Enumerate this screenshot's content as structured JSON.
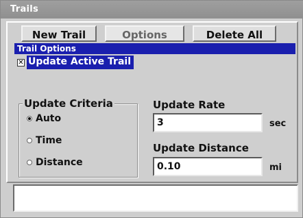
{
  "window": {
    "title": "Trails"
  },
  "toolbar": {
    "new_trail": "New Trail",
    "options": "Options",
    "delete_all": "Delete All"
  },
  "menu": {
    "title": "Trail Options"
  },
  "update_active_trail": {
    "label": "Update Active Trail",
    "checked": true
  },
  "criteria": {
    "legend": "Update Criteria",
    "options": [
      {
        "label": "Auto",
        "selected": true
      },
      {
        "label": "Time",
        "selected": false
      },
      {
        "label": "Distance",
        "selected": false
      }
    ]
  },
  "update_rate": {
    "label": "Update Rate",
    "value": "3",
    "unit": "sec"
  },
  "update_distance": {
    "label": "Update Distance",
    "value": "0.10",
    "unit": "mi"
  },
  "colors": {
    "menu_highlight": "#1a1fae",
    "title_bar": "#959595",
    "panel": "#cfcfcf"
  }
}
